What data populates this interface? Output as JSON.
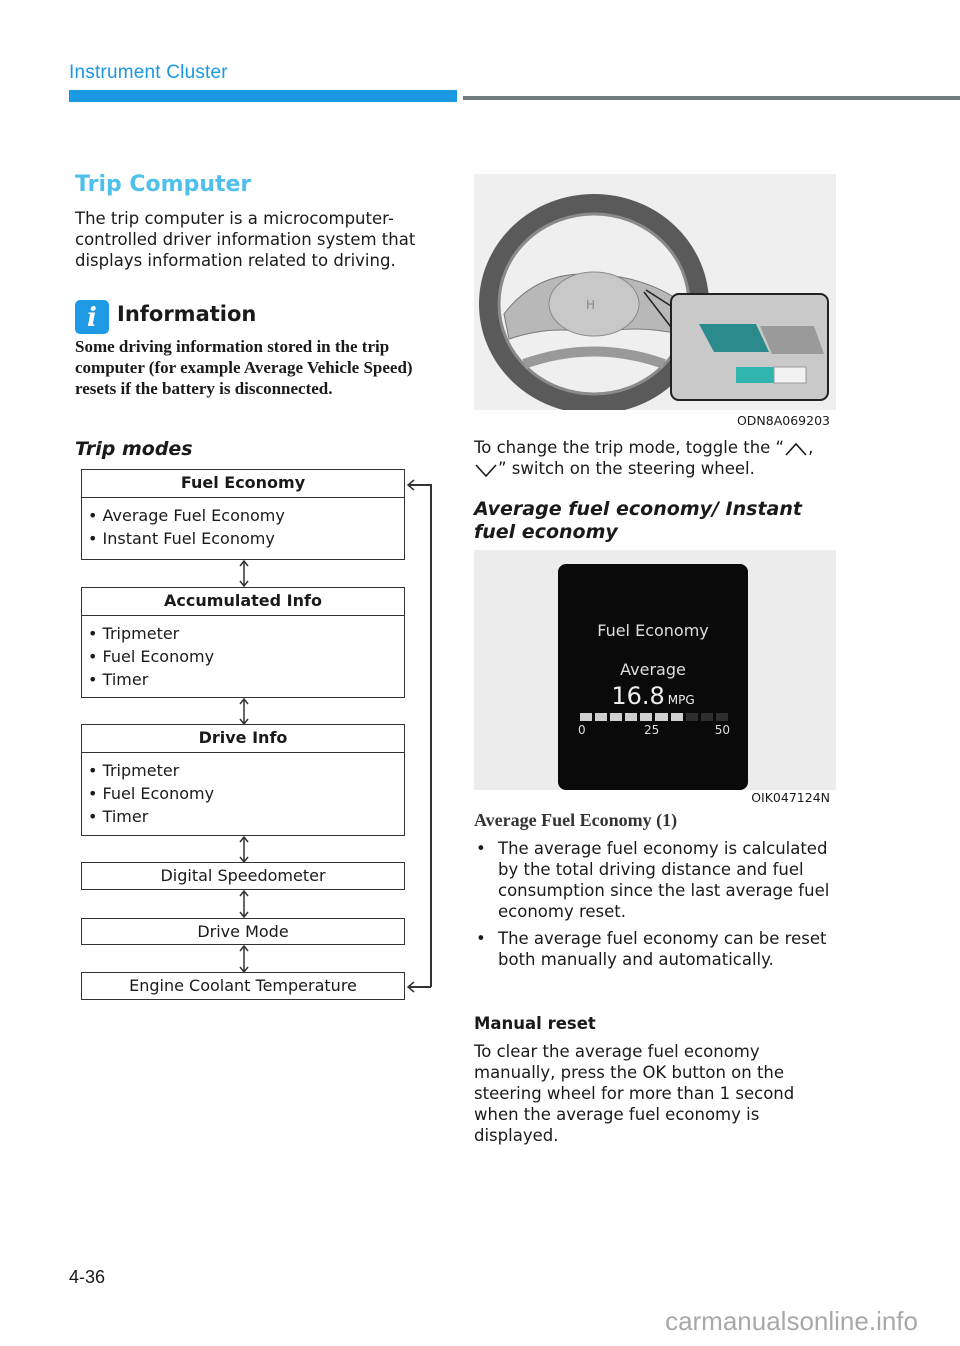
{
  "header": {
    "section_title": "Instrument Cluster",
    "accent_color": "#1a98e2"
  },
  "left": {
    "heading": "Trip Computer",
    "intro": "The trip computer is a microcomputer-controlled driver information system that displays information related to driving.",
    "info": {
      "icon": "info-icon",
      "title": "Information",
      "body": "Some driving information stored in the trip computer (for example Average Vehicle Speed) resets if the battery is disconnected."
    },
    "modes_heading": "Trip modes",
    "modes": [
      {
        "title": "Fuel Economy",
        "items": [
          "Average Fuel Economy",
          "Instant Fuel Economy"
        ]
      },
      {
        "title": "Accumulated Info",
        "items": [
          "Tripmeter",
          "Fuel Economy",
          "Timer"
        ]
      },
      {
        "title": "Drive Info",
        "items": [
          "Tripmeter",
          "Fuel Economy",
          "Timer"
        ]
      },
      {
        "title": "Digital Speedometer"
      },
      {
        "title": "Drive Mode"
      },
      {
        "title": "Engine Coolant Temperature"
      }
    ]
  },
  "right": {
    "wheel_image_caption": "ODN8A069203",
    "toggle_text_pre": "To change the trip mode, toggle the “",
    "toggle_text_mid": ",",
    "toggle_text_post": "” switch on the steering wheel.",
    "subheading": "Average fuel economy/ Instant fuel economy",
    "cluster_display": {
      "title": "Fuel Economy",
      "label": "Average",
      "value": "16.8",
      "unit": "MPG",
      "gauge_min": "0",
      "gauge_mid": "25",
      "gauge_max": "50",
      "gauge_fill_fraction": 0.65
    },
    "cluster_image_caption": "OIK047124N",
    "avg_heading": "Average Fuel Economy (1)",
    "bullets": [
      "The average fuel economy is calculated by the total driving distance and fuel consumption since the last average fuel economy reset.",
      "The average fuel economy can be reset both manually and automatically."
    ],
    "manual_reset_heading": "Manual reset",
    "manual_reset_body": "To clear the average fuel economy manually, press the OK button on the steering wheel for more than 1 second when the average fuel economy is displayed."
  },
  "footer": {
    "page_number": "4-36",
    "watermark": "carmanualsonline.info"
  }
}
